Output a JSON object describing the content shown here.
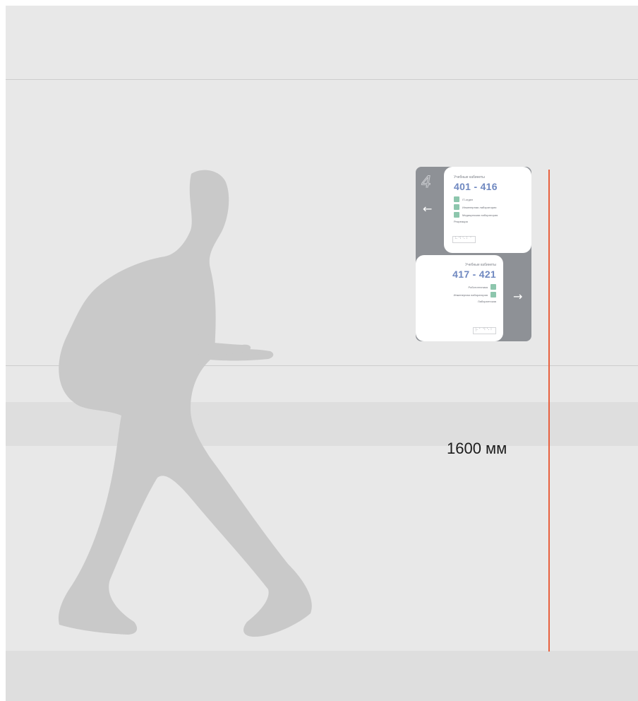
{
  "measurement": {
    "label": "1600 мм",
    "color": "#e8603e"
  },
  "sign": {
    "floor_number": "4",
    "top": {
      "caption": "Учебные кабинеты",
      "range": "401 - 416",
      "items": [
        {
          "label": "IT-отдел",
          "icon": "room-badge-icon"
        },
        {
          "label": "Инженерная лаборатория",
          "icon": "room-badge-icon"
        },
        {
          "label": "Медицинская лаборатория",
          "icon": "room-badge-icon"
        }
      ],
      "extra": "Рекреация",
      "braille": "⠓⠙⠑⠃⠁",
      "arrow": "←"
    },
    "bottom": {
      "caption": "Учебные кабинеты",
      "range": "417 - 421",
      "items": [
        {
          "label": "Робототехника",
          "icon": "room-badge-icon"
        },
        {
          "label": "Инженерная лаборатория",
          "icon": "room-badge-icon"
        }
      ],
      "extra": "Лаборантская",
      "braille": "⠗⠁⠙⠑⠃",
      "arrow": "→"
    },
    "colors": {
      "frame": "#8e9196",
      "accent_text": "#6f88c0",
      "badge": "#8dc6ad"
    }
  },
  "scene": {
    "wall": "#e8e8e8",
    "band": "#dedede",
    "silhouette": "#c9c9c9"
  }
}
